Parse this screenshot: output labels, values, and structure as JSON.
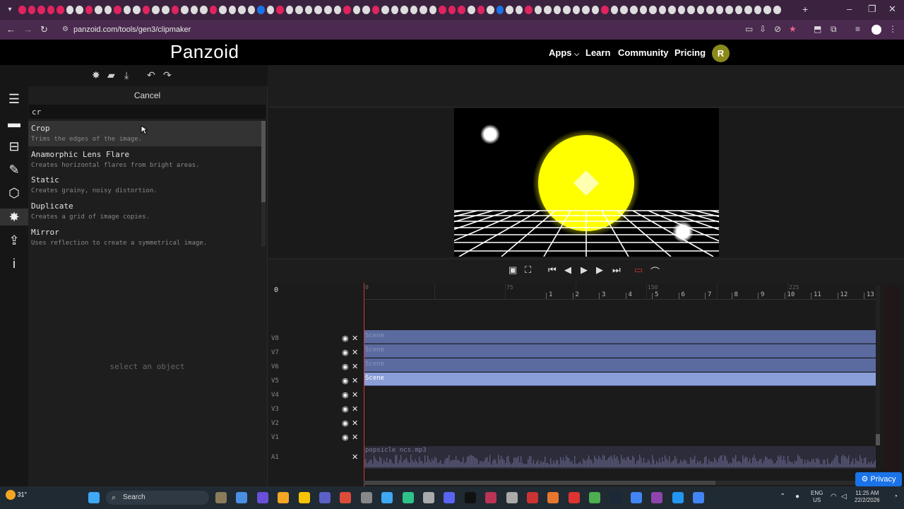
{
  "browser": {
    "url": "panzoid.com/tools/gen3/clipmaker",
    "tab_colors": [
      "#e0245e",
      "#e0245e",
      "#e0245e",
      "#e0245e",
      "#e0245e",
      "#ddd",
      "#ddd",
      "#e0245e",
      "#ddd",
      "#ddd",
      "#e0245e",
      "#ddd",
      "#ddd",
      "#e0245e",
      "#ddd",
      "#ddd",
      "#e0245e",
      "#ddd",
      "#ddd",
      "#ddd",
      "#e0245e",
      "#ddd",
      "#ddd",
      "#ddd",
      "#ddd",
      "#1a73e8",
      "#ddd",
      "#e0245e",
      "#ddd",
      "#ddd",
      "#ddd",
      "#ddd",
      "#ddd",
      "#ddd",
      "#e0245e",
      "#ddd",
      "#ddd",
      "#e0245e",
      "#ddd",
      "#ddd",
      "#ddd",
      "#ddd",
      "#ddd",
      "#ddd",
      "#e0245e",
      "#e0245e",
      "#e0245e",
      "#ddd",
      "#e0245e",
      "#ddd",
      "#1a73e8",
      "#ddd",
      "#ddd",
      "#e0245e",
      "#ddd",
      "#ddd",
      "#ddd",
      "#ddd",
      "#ddd",
      "#ddd",
      "#ddd",
      "#e0245e",
      "#ddd",
      "#ddd",
      "#ddd",
      "#ddd",
      "#ddd",
      "#ddd",
      "#ddd",
      "#ddd",
      "#ddd",
      "#ddd",
      "#ddd",
      "#ddd",
      "#ddd",
      "#ddd",
      "#ddd",
      "#ddd",
      "#ddd",
      "#ddd"
    ],
    "profile_initial": ""
  },
  "site": {
    "logo": "Panzoid",
    "nav": {
      "apps": "Apps",
      "learn": "Learn",
      "community": "Community",
      "pricing": "Pricing"
    },
    "avatar_initial": "R"
  },
  "left_panel": {
    "cancel_label": "Cancel",
    "search_value": "cr",
    "effects": [
      {
        "name": "Crop",
        "desc": "Trims the edges of the image."
      },
      {
        "name": "Anamorphic Lens Flare",
        "desc": "Creates horizontal flares from bright areas."
      },
      {
        "name": "Static",
        "desc": "Creates grainy, noisy distortion."
      },
      {
        "name": "Duplicate",
        "desc": "Creates a grid of image copies."
      },
      {
        "name": "Mirror",
        "desc": "Uses reflection to create a symmetrical image."
      }
    ],
    "empty_message": "select an object"
  },
  "timeline": {
    "current_frame": "0",
    "ruler_major": [
      "0",
      "75",
      "150",
      "225"
    ],
    "ruler_seconds": [
      "1",
      "2",
      "3",
      "4",
      "5",
      "6",
      "7",
      "8",
      "9",
      "10",
      "11",
      "12",
      "13"
    ],
    "tracks": [
      {
        "label": "V8",
        "clip": "Scene",
        "selected": false
      },
      {
        "label": "V7",
        "clip": "Scene",
        "selected": false
      },
      {
        "label": "V6",
        "clip": "Scene",
        "selected": false
      },
      {
        "label": "V5",
        "clip": "Scene",
        "selected": true
      },
      {
        "label": "V4",
        "clip": "",
        "selected": false
      },
      {
        "label": "V3",
        "clip": "",
        "selected": false
      },
      {
        "label": "V2",
        "clip": "",
        "selected": false
      },
      {
        "label": "V1",
        "clip": "",
        "selected": false
      }
    ],
    "audio_label": "A1",
    "audio_clip": "popsicle ncs.mp3"
  },
  "privacy_label": "Privacy",
  "taskbar": {
    "weather": "31°",
    "search_label": "Search",
    "lang_line1": "ENG",
    "lang_line2": "US",
    "time": "11:25 AM",
    "date": "22/2/2026"
  },
  "colors": {
    "clip": "#5b6ba0",
    "clip_selected": "#8a9fd8",
    "sun": "#ffff00",
    "playhead": "#dd3333",
    "privacy": "#1a73e8"
  }
}
